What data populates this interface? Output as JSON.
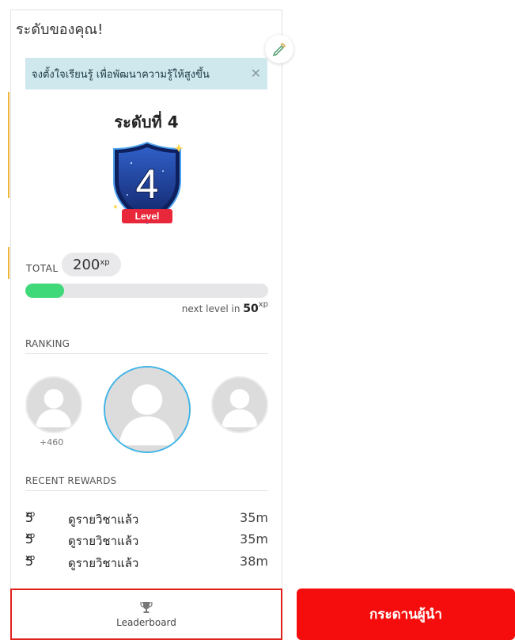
{
  "panel": {
    "title": "ระดับของคุณ!",
    "banner": {
      "text": "จงตั้งใจเรียนรู้ เพื่อพัฒนาความรู้ให้สูงขึ้น",
      "close_icon": "close-icon"
    },
    "level": {
      "title": "ระดับที่ 4",
      "badge_number": "4",
      "badge_label": "Level"
    },
    "total": {
      "label": "TOTAL",
      "value": "200",
      "unit": "xp"
    },
    "progress": {
      "fraction": 0.16,
      "next_prefix": "next level in",
      "next_value": "50",
      "unit": "xp"
    },
    "ranking": {
      "label": "RANKING",
      "left_delta": "+460"
    },
    "rewards": {
      "label": "RECENT REWARDS",
      "items": [
        {
          "xp": "5",
          "unit": "xp",
          "desc": "ดูรายวิชาแล้ว",
          "time": "35m"
        },
        {
          "xp": "5",
          "unit": "xp",
          "desc": "ดูรายวิชาแล้ว",
          "time": "35m"
        },
        {
          "xp": "5",
          "unit": "xp",
          "desc": "ดูรายวิชาแล้ว",
          "time": "38m"
        }
      ]
    },
    "leaderboard": {
      "label": "Leaderboard",
      "icon": "trophy-icon"
    }
  },
  "cta": {
    "label": "กระดานผู้นำ"
  },
  "colors": {
    "accent_green": "#3fd979",
    "banner_bg": "#cfe8ee",
    "avatar_ring": "#3fb4e8",
    "cta_red": "#f50d0d",
    "highlight_border": "#e0201a",
    "badge_blue": "#1a3a8f",
    "badge_ribbon": "#e8283a"
  }
}
